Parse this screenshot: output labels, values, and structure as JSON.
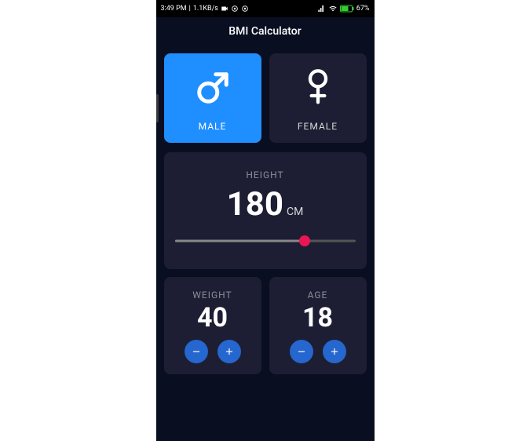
{
  "status": {
    "time": "3:49 PM",
    "net_speed": "1.1KB/s",
    "battery": "67%"
  },
  "app": {
    "title": "BMI Calculator"
  },
  "gender": {
    "male_label": "MALE",
    "female_label": "FEMALE",
    "selected": "male"
  },
  "height": {
    "label": "HEIGHT",
    "value": "180",
    "unit": "CM",
    "min": 100,
    "max": 220
  },
  "weight": {
    "label": "WEIGHT",
    "value": "40"
  },
  "age": {
    "label": "AGE",
    "value": "18"
  },
  "colors": {
    "card_bg": "#1d1e33",
    "active_card_bg": "#1f8fff",
    "accent": "#eb1555",
    "btn_bg": "#2566cf",
    "scaffold_bg": "#0a0e21",
    "inactive_text": "#8d8e98"
  }
}
